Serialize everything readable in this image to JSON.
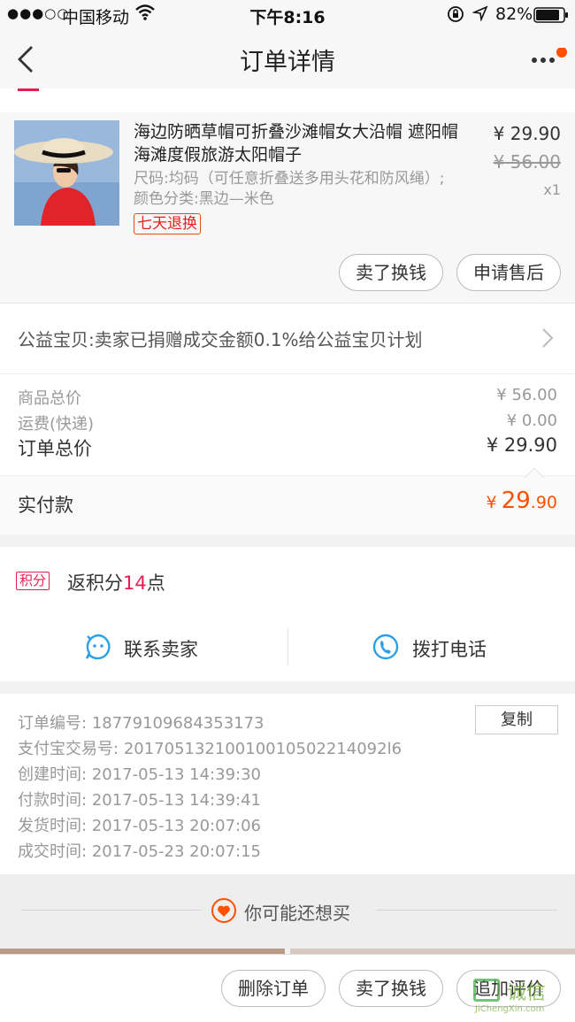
{
  "status_bar": {
    "signal": "●●●○○",
    "carrier": "中国移动",
    "time": "下午8:16",
    "battery": "82%"
  },
  "nav": {
    "title": "订单详情"
  },
  "product": {
    "title": "海边防晒草帽可折叠沙滩帽女大沿帽 遮阳帽 海滩度假旅游太阳帽子",
    "spec": "尺码:均码（可任意折叠送多用头花和防风绳）;颜色分类:黑边—米色",
    "tag": "七天退换",
    "price": "¥ 29.90",
    "original_price": "¥ 56.00",
    "quantity": "x1",
    "actions": [
      "卖了换钱",
      "申请售后"
    ]
  },
  "charity": {
    "text": "公益宝贝:卖家已捐赠成交金额0.1%给公益宝贝计划"
  },
  "pricing": {
    "goods_total_label": "商品总价",
    "goods_total_value": "¥ 56.00",
    "shipping_label": "运费(快递)",
    "shipping_value": "¥ 0.00",
    "order_total_label": "订单总价",
    "order_total_value": "¥ 29.90",
    "paid_label": "实付款",
    "paid_currency": "¥",
    "paid_main": "29",
    "paid_decimal": ".90"
  },
  "points": {
    "badge": "积分",
    "prefix": "返积分",
    "value": "14",
    "suffix": "点"
  },
  "contact": {
    "seller": "联系卖家",
    "phone": "拨打电话"
  },
  "order_info": {
    "copy": "复制",
    "lines": [
      {
        "label": "订单编号:",
        "value": "18779109684353173"
      },
      {
        "label": "支付宝交易号:",
        "value": "20170513210010010502214092l6"
      },
      {
        "label": "创建时间:",
        "value": "2017-05-13 14:39:30"
      },
      {
        "label": "付款时间:",
        "value": "2017-05-13 14:39:41"
      },
      {
        "label": "发货时间:",
        "value": "2017-05-13 20:07:06"
      },
      {
        "label": "成交时间:",
        "value": "2017-05-23 20:07:15"
      }
    ]
  },
  "recommend": {
    "title": "你可能还想买"
  },
  "bottom_bar": {
    "delete": "删除订单",
    "sell": "卖了换钱",
    "review": "追加评价"
  },
  "watermark": {
    "cn": "诚信",
    "en": "JiChengXin.com"
  },
  "colors": {
    "accent": "#ff5000",
    "tag_red": "#e2231a",
    "points_red": "#e61e50",
    "icon_blue": "#2aa0e6"
  }
}
